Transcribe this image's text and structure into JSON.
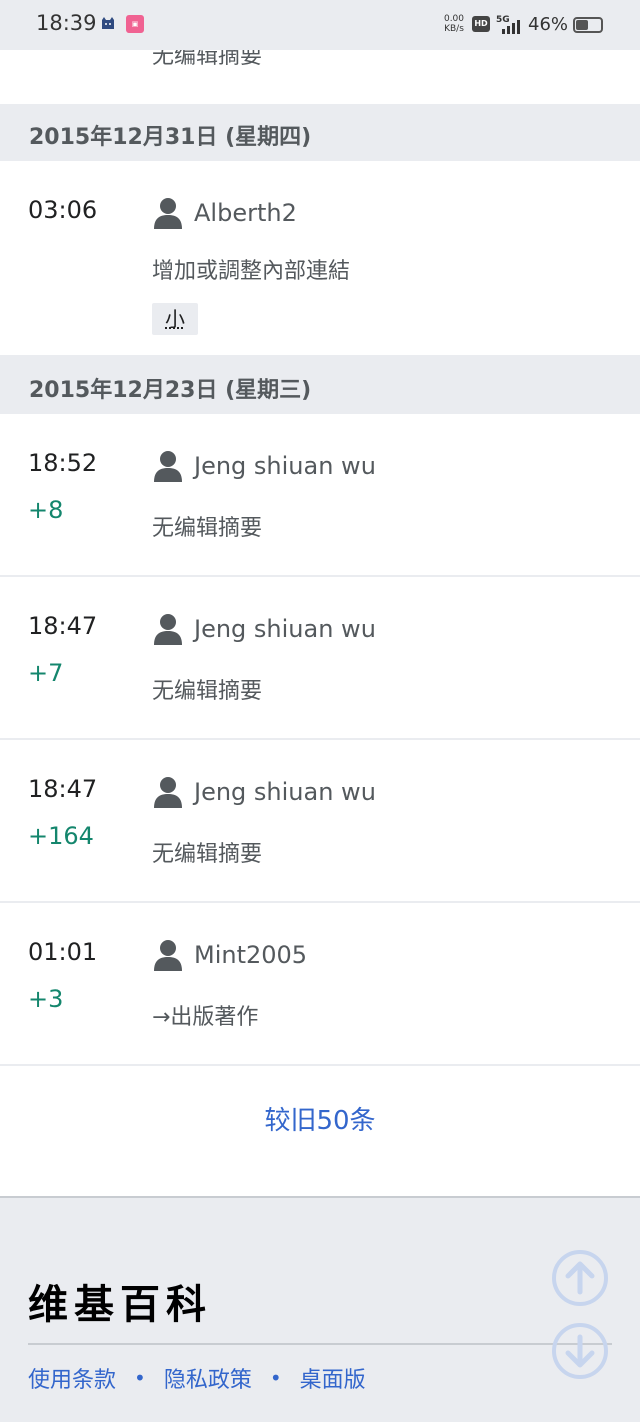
{
  "status_bar": {
    "time": "18:39",
    "net_speed_value": "0.00",
    "net_speed_unit": "KB/s",
    "hd_badge": "HD",
    "network": "5G",
    "battery_percent": "46%",
    "battery_level": 0.46
  },
  "history": {
    "clipped_summary": "无编辑摘要",
    "groups": [
      {
        "date": "2015年12月31日 (星期四)",
        "rows": [
          {
            "time": "03:06",
            "diff": "",
            "user": "Alberth2",
            "summary": "增加或調整內部連結",
            "minor": "小"
          }
        ]
      },
      {
        "date": "2015年12月23日 (星期三)",
        "rows": [
          {
            "time": "18:52",
            "diff": "+8",
            "user": "Jeng shiuan wu",
            "summary": "无编辑摘要"
          },
          {
            "time": "18:47",
            "diff": "+7",
            "user": "Jeng shiuan wu",
            "summary": "无编辑摘要"
          },
          {
            "time": "18:47",
            "diff": "+164",
            "user": "Jeng shiuan wu",
            "summary": "无编辑摘要"
          },
          {
            "time": "01:01",
            "diff": "+3",
            "user": "Mint2005",
            "summary": "→出版著作"
          }
        ]
      }
    ],
    "older_link": "较旧50条"
  },
  "footer": {
    "wordmark": "维基百科",
    "links": [
      "使用条款",
      "隐私政策",
      "桌面版"
    ],
    "separator": "•"
  },
  "colors": {
    "link": "#3366cc",
    "positive_diff": "#14866d",
    "header_bg": "#eaecf0"
  }
}
